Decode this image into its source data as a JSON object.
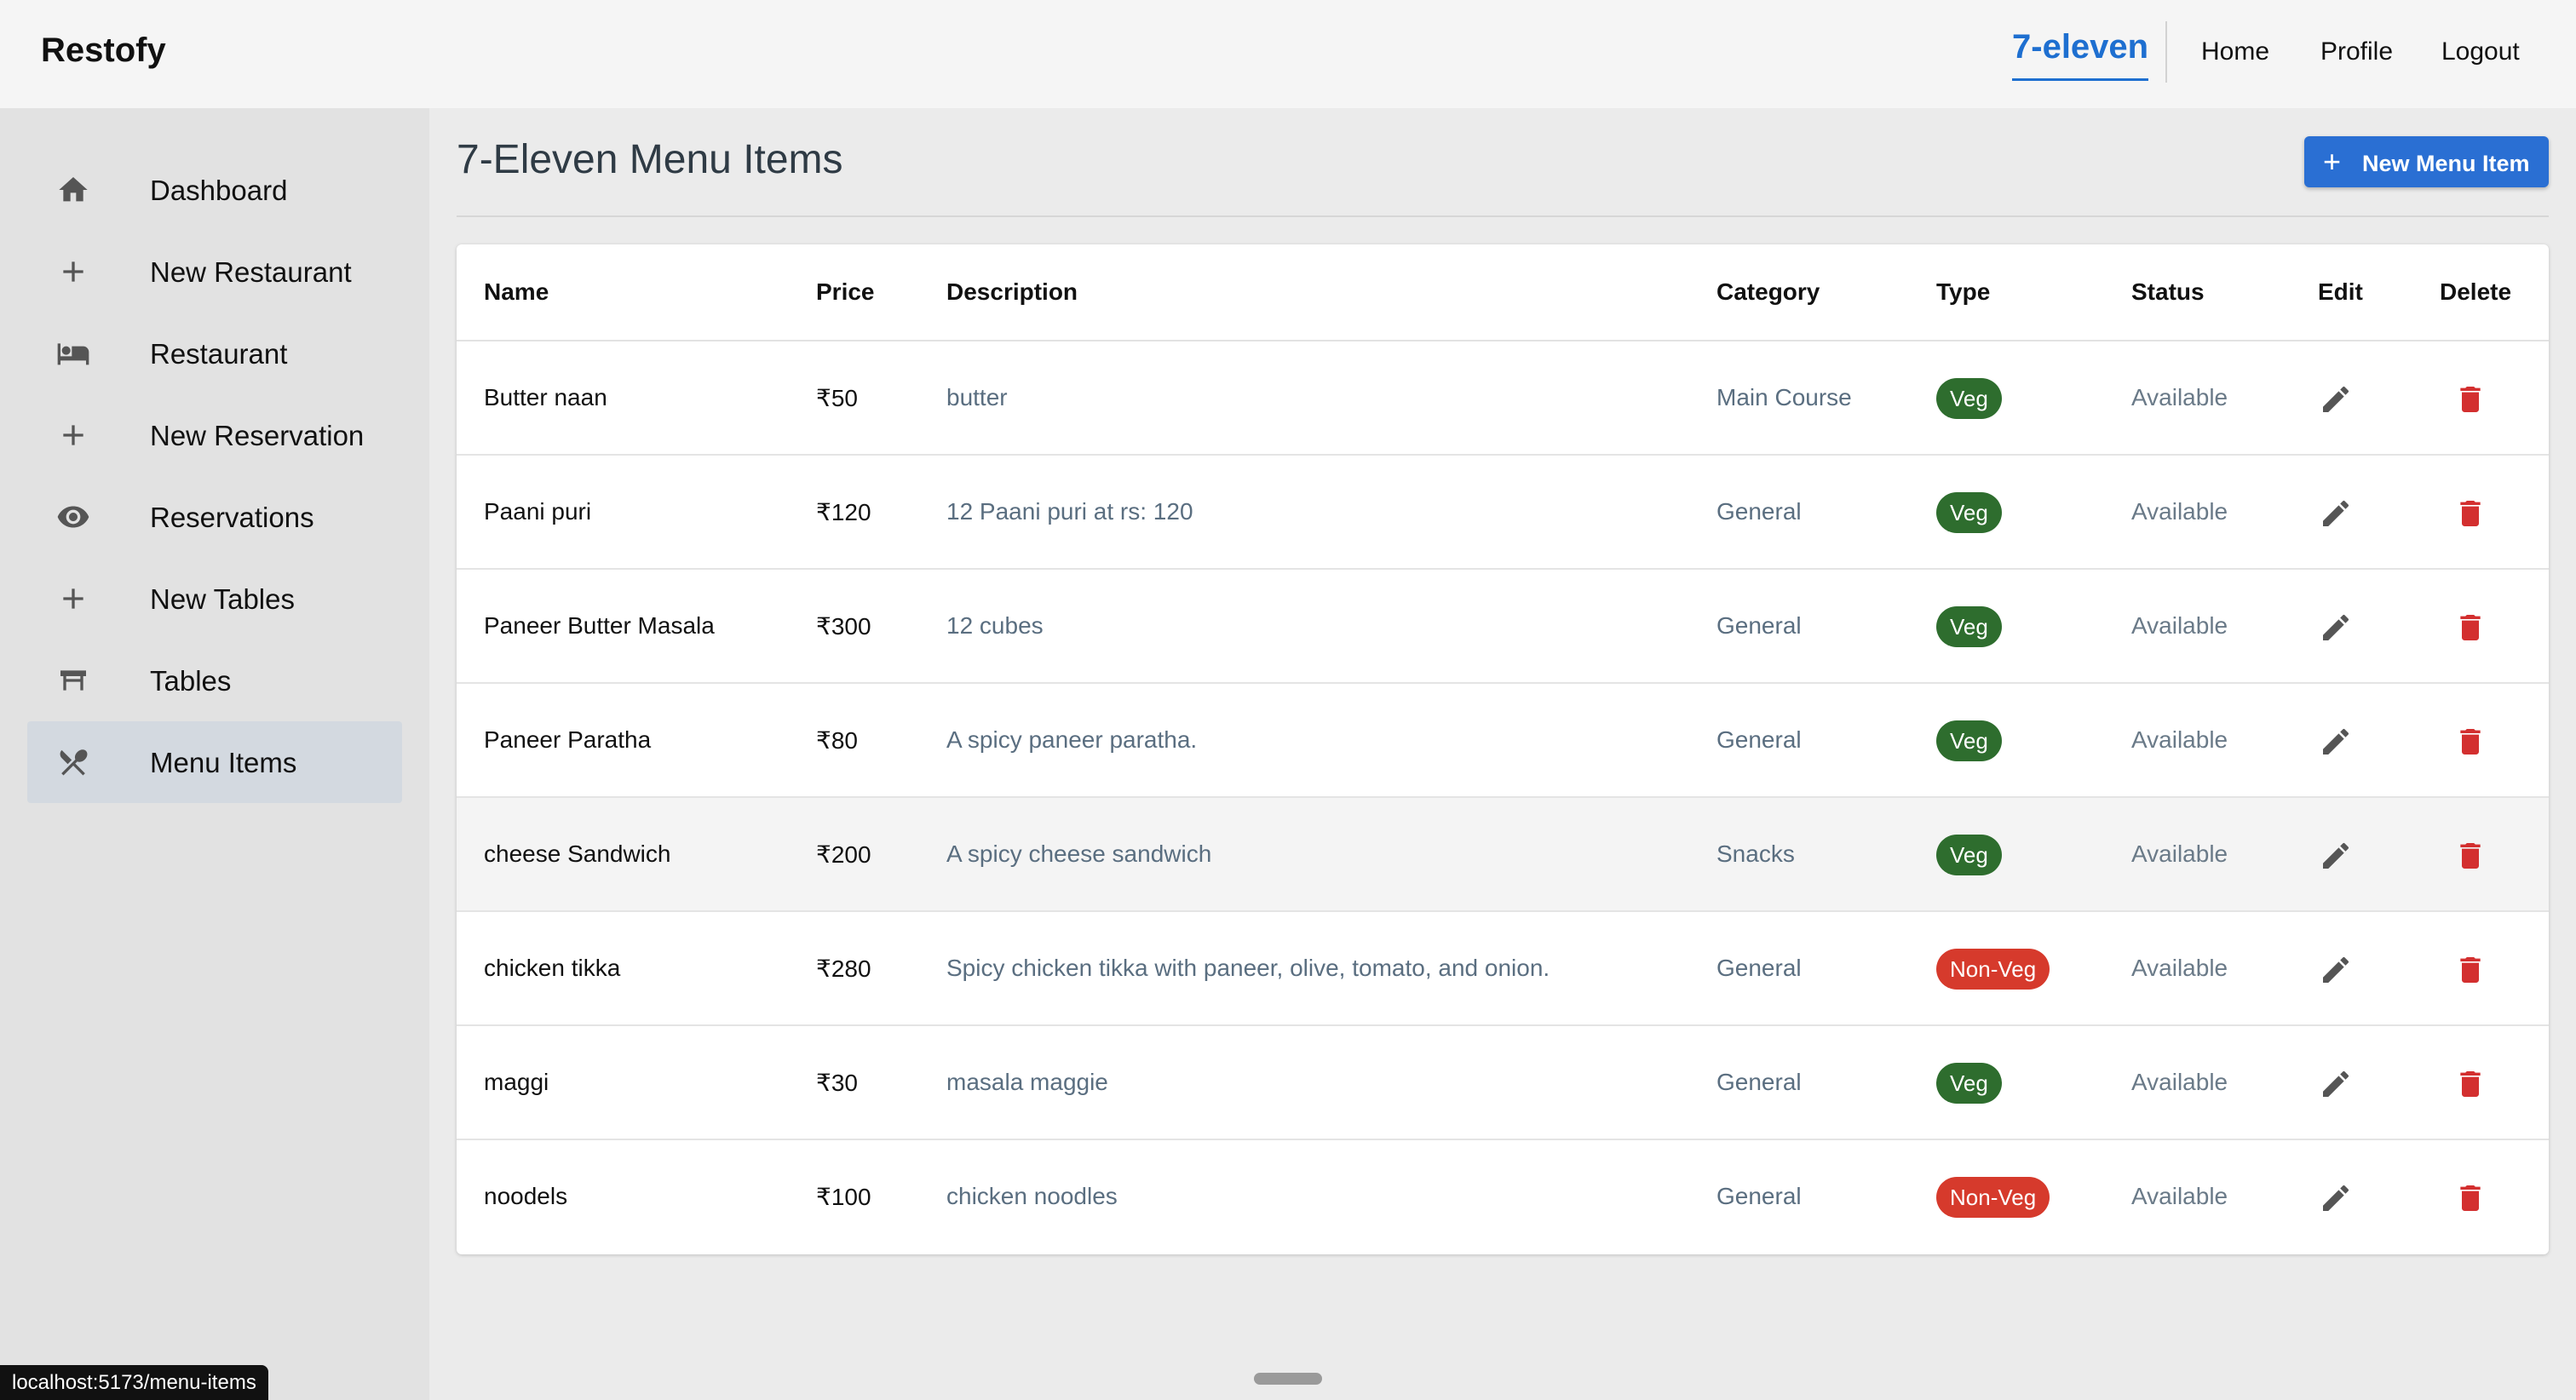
{
  "header": {
    "brand": "Restofy",
    "restaurant_name": "7-eleven",
    "nav": {
      "home": "Home",
      "profile": "Profile",
      "logout": "Logout"
    }
  },
  "sidebar": {
    "items": [
      {
        "label": "Dashboard",
        "icon": "home-icon"
      },
      {
        "label": "New Restaurant",
        "icon": "plus-icon"
      },
      {
        "label": "Restaurant",
        "icon": "bed-icon"
      },
      {
        "label": "New Reservation",
        "icon": "plus-icon"
      },
      {
        "label": "Reservations",
        "icon": "eye-icon"
      },
      {
        "label": "New Tables",
        "icon": "plus-icon"
      },
      {
        "label": "Tables",
        "icon": "table-icon"
      },
      {
        "label": "Menu Items",
        "icon": "utensils-icon",
        "active": true
      }
    ]
  },
  "main": {
    "title": "7-Eleven Menu Items",
    "new_button": "New Menu Item",
    "columns": {
      "name": "Name",
      "price": "Price",
      "description": "Description",
      "category": "Category",
      "type": "Type",
      "status": "Status",
      "edit": "Edit",
      "delete": "Delete"
    },
    "rows": [
      {
        "name": "Butter naan",
        "price": "₹50",
        "description": "butter",
        "category": "Main Course",
        "type": "Veg",
        "status": "Available"
      },
      {
        "name": "Paani puri",
        "price": "₹120",
        "description": "12 Paani puri at rs: 120",
        "category": "General",
        "type": "Veg",
        "status": "Available"
      },
      {
        "name": "Paneer Butter Masala",
        "price": "₹300",
        "description": "12 cubes",
        "category": "General",
        "type": "Veg",
        "status": "Available"
      },
      {
        "name": "Paneer Paratha",
        "price": "₹80",
        "description": "A spicy paneer paratha.",
        "category": "General",
        "type": "Veg",
        "status": "Available"
      },
      {
        "name": "cheese Sandwich",
        "price": "₹200",
        "description": "A spicy cheese sandwich",
        "category": "Snacks",
        "type": "Veg",
        "status": "Available",
        "hovered": true
      },
      {
        "name": "chicken tikka",
        "price": "₹280",
        "description": "Spicy chicken tikka with paneer, olive, tomato, and onion.",
        "category": "General",
        "type": "Non-Veg",
        "status": "Available"
      },
      {
        "name": "maggi",
        "price": "₹30",
        "description": "masala maggie",
        "category": "General",
        "type": "Veg",
        "status": "Available"
      },
      {
        "name": "noodels",
        "price": "₹100",
        "description": "chicken noodles",
        "category": "General",
        "type": "Non-Veg",
        "status": "Available"
      }
    ]
  },
  "browser_status": {
    "url": "localhost:5173/menu-items"
  },
  "colors": {
    "accent": "#2a6fd3",
    "veg": "#2e6d2e",
    "non_veg": "#d63a2c",
    "delete": "#d32f2f",
    "sidebar_active": "#d3d9e0"
  }
}
